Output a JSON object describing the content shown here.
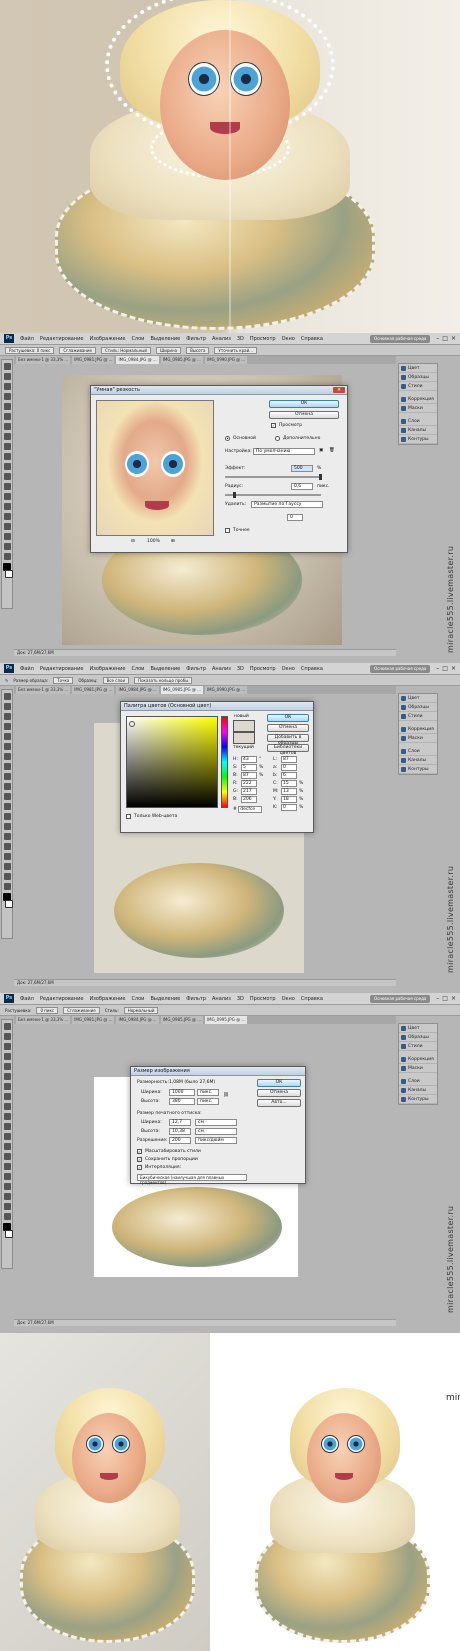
{
  "watermark": "miracle555.livemaster.ru",
  "ps": {
    "app_logo": "Ps",
    "menu": [
      "Файл",
      "Редактирование",
      "Изображение",
      "Слои",
      "Выделение",
      "Фильтр",
      "Анализ",
      "3D",
      "Просмотр",
      "Окно",
      "Справка"
    ],
    "essentials": "Основная рабочая среда",
    "window_controls": [
      "–",
      "□",
      "×"
    ],
    "doc_tabs": [
      "Без имени-1 @ 33,3% ...",
      "IMG_0981.JPG @ ...",
      "IMG_0984.JPG @ ...",
      "IMG_0985.JPG @ ...",
      "IMG_0990.JPG @ ...",
      "IMG_0995.JPG @ ..."
    ],
    "panel_items": [
      "Цвет",
      "Образцы",
      "Стили",
      "Коррекция",
      "Маски",
      "Слои",
      "Каналы",
      "Контуры"
    ],
    "status": "Док: 27,6М/27,6М"
  },
  "screen1": {
    "options": [
      "Растушевка: 0 пикс",
      "Сглаживание",
      "Стиль: Нормальный",
      "Ширина",
      "Высота",
      "Уточнить край..."
    ],
    "dialog": {
      "title": "\"Умная\" резкость",
      "close": "×",
      "ok": "ОК",
      "cancel": "Отмена",
      "preview": "Просмотр",
      "mode_basic": "Основной",
      "mode_advanced": "Дополнительно",
      "settings_label": "Настройка:",
      "settings_value": "По умолчанию",
      "amount_label": "Эффект:",
      "amount_value": "500",
      "amount_unit": "%",
      "radius_label": "Радиус:",
      "radius_value": "0,6",
      "radius_unit": "пикс.",
      "remove_label": "Удалить:",
      "remove_value": "Размытие по Гауссу",
      "angle_value": "0",
      "more_accurate": "Точнее",
      "zoom": "100%"
    }
  },
  "screen2": {
    "options": [
      "Размер образца:",
      "Точка",
      "Образец:",
      "Все слои",
      "Показать кольцо пробы"
    ],
    "dialog": {
      "title": "Палитра цветов (Основной цвет)",
      "ok": "ОК",
      "cancel": "Отмена",
      "add_swatches": "Добавить в образцы",
      "libraries": "Библиотеки цветов",
      "new_label": "новый",
      "current_label": "текущий",
      "web_only": "Только Web-цвета",
      "fields": [
        {
          "l": "H:",
          "v": "43",
          "u": "°"
        },
        {
          "l": "S:",
          "v": "5",
          "u": "%"
        },
        {
          "l": "B:",
          "v": "87",
          "u": "%"
        },
        {
          "l": "R:",
          "v": "222",
          "u": ""
        },
        {
          "l": "G:",
          "v": "217",
          "u": ""
        },
        {
          "l": "B:",
          "v": "206",
          "u": ""
        }
      ],
      "fields2": [
        {
          "l": "L:",
          "v": "87",
          "u": ""
        },
        {
          "l": "a:",
          "v": "0",
          "u": ""
        },
        {
          "l": "b:",
          "v": "6",
          "u": ""
        },
        {
          "l": "C:",
          "v": "15",
          "u": "%"
        },
        {
          "l": "M:",
          "v": "13",
          "u": "%"
        },
        {
          "l": "Y:",
          "v": "18",
          "u": "%"
        },
        {
          "l": "K:",
          "v": "0",
          "u": "%"
        }
      ],
      "hex": "decfce",
      "colors": {
        "new": "#ded9ce",
        "current": "#ded9ce"
      }
    }
  },
  "screen3": {
    "options": [
      "Растушевка:",
      "0 пикс",
      "Сглаживание",
      "Стиль:",
      "Нормальный"
    ],
    "dialog": {
      "title": "Размер изображения",
      "ok": "ОК",
      "cancel": "Отмена",
      "auto": "Авто...",
      "dims_label": "Размерность:",
      "dims_value": "1,08М (было 27,6М)",
      "width_label": "Ширина:",
      "width_value": "1000",
      "height_label": "Высота:",
      "height_value": "380",
      "px_unit": "пикс.",
      "print_header": "Размер печатного оттиска:",
      "pw_label": "Ширина:",
      "pw_value": "12,7",
      "ph_label": "Высота:",
      "ph_value": "10,38",
      "cm_unit": "см",
      "res_label": "Разрешение:",
      "res_value": "200",
      "res_unit": "пикс/дюйм",
      "scale_styles": "Масштабировать стили",
      "constrain": "Сохранить пропорции",
      "resample": "Интерполяция:",
      "resample_value": "Бикубическая (наилучшая для плавных градиентов)"
    }
  }
}
